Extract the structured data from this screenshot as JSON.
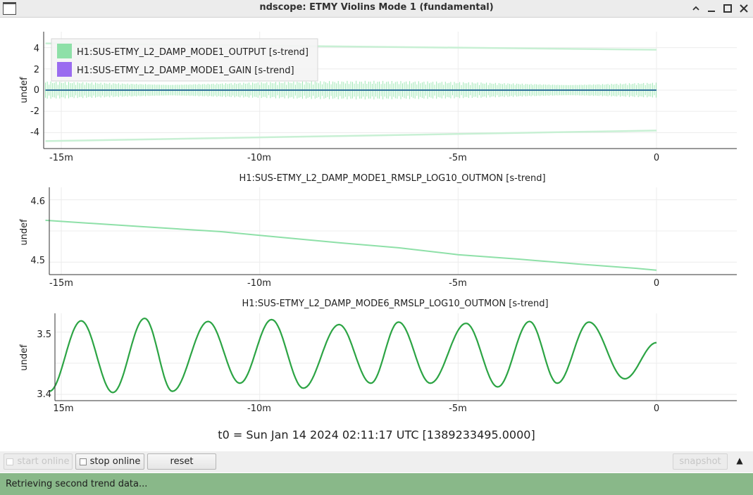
{
  "window": {
    "title": "ndscope: ETMY Violins Mode 1 (fundamental)",
    "controls": {
      "minimize": "–",
      "restore": "^",
      "maximize": "□",
      "close": "✕"
    }
  },
  "plot1": {
    "ylabel": "undef",
    "yticks": [
      "4",
      "2",
      "0",
      "-2",
      "-4"
    ],
    "xticks": [
      "-15m",
      "-10m",
      "-5m",
      "0"
    ],
    "legend": [
      {
        "label": "H1:SUS-ETMY_L2_DAMP_MODE1_OUTPUT [s-trend]",
        "color": "#8ee0a8"
      },
      {
        "label": "H1:SUS-ETMY_L2_DAMP_MODE1_GAIN [s-trend]",
        "color": "#9a6cf0"
      }
    ]
  },
  "plot2": {
    "title": "H1:SUS-ETMY_L2_DAMP_MODE1_RMSLP_LOG10_OUTMON [s-trend]",
    "ylabel": "undef",
    "yticks": [
      "4.6",
      "4.5"
    ],
    "xticks": [
      "-15m",
      "-10m",
      "-5m",
      "0"
    ],
    "color": "#8ee0a8"
  },
  "plot3": {
    "title": "H1:SUS-ETMY_L2_DAMP_MODE6_RMSLP_LOG10_OUTMON [s-trend]",
    "ylabel": "undef",
    "yticks": [
      "3.5",
      "3.4"
    ],
    "xticks": [
      "15m",
      "-10m",
      "-5m",
      "0"
    ],
    "color": "#2ca444"
  },
  "t0_label": "t0 = Sun Jan 14 2024 02:11:17 UTC [1389233495.0000]",
  "toolbar": {
    "start_online": "start online",
    "stop_online": "stop online",
    "reset": "reset",
    "snapshot": "snapshot",
    "collapse_icon": "▲"
  },
  "status": "Retrieving second trend data...",
  "chart_data": [
    {
      "type": "line",
      "title": "",
      "ylabel": "undef",
      "ylim": [
        -5.5,
        5.5
      ],
      "xlim": [
        -15.5,
        2
      ],
      "series": [
        {
          "name": "H1:SUS-ETMY_L2_DAMP_MODE1_OUTPUT [s-trend]",
          "note": "noise band",
          "x": [
            -15.4,
            0
          ],
          "min": [
            -0.9,
            -0.85
          ],
          "max": [
            0.9,
            0.85
          ]
        },
        {
          "name": "H1:SUS-ETMY_L2_DAMP_MODE1_OUTPUT [s-trend]",
          "x": [
            -15.4,
            0
          ],
          "upper": [
            4.4,
            3.8
          ],
          "lower": [
            -4.8,
            -3.8
          ]
        },
        {
          "name": "H1:SUS-ETMY_L2_DAMP_MODE1_GAIN [s-trend]",
          "x": [
            -15.4,
            0
          ],
          "values": [
            0,
            0
          ]
        }
      ]
    },
    {
      "type": "line",
      "title": "H1:SUS-ETMY_L2_DAMP_MODE1_RMSLP_LOG10_OUTMON [s-trend]",
      "ylabel": "undef",
      "ylim": [
        4.48,
        4.62
      ],
      "xlim": [
        -15.5,
        2
      ],
      "series": [
        {
          "name": "H1:SUS-ETMY_L2_DAMP_MODE1_RMSLP_LOG10_OUTMON [s-trend]",
          "x": [
            -15.4,
            -13,
            -11,
            -9.5,
            -8,
            -6.5,
            -5,
            -3.5,
            -2,
            -0.5,
            0
          ],
          "values": [
            4.567,
            4.557,
            4.549,
            4.54,
            4.531,
            4.523,
            4.512,
            4.505,
            4.497,
            4.49,
            4.487
          ]
        }
      ]
    },
    {
      "type": "line",
      "title": "H1:SUS-ETMY_L2_DAMP_MODE6_RMSLP_LOG10_OUTMON [s-trend]",
      "ylabel": "undef",
      "ylim": [
        3.39,
        3.53
      ],
      "xlim": [
        -15.5,
        2
      ],
      "series": [
        {
          "name": "H1:SUS-ETMY_L2_DAMP_MODE6_RMSLP_LOG10_OUTMON [s-trend]",
          "x": [
            -15.3,
            -14.5,
            -13.7,
            -12.9,
            -12.2,
            -11.3,
            -10.5,
            -9.7,
            -8.9,
            -8.0,
            -7.2,
            -6.5,
            -5.7,
            -4.8,
            -4.0,
            -3.2,
            -2.5,
            -1.7,
            -0.8,
            0
          ],
          "values": [
            3.405,
            3.518,
            3.403,
            3.522,
            3.405,
            3.517,
            3.418,
            3.52,
            3.41,
            3.512,
            3.418,
            3.516,
            3.418,
            3.514,
            3.412,
            3.517,
            3.418,
            3.516,
            3.425,
            3.483
          ]
        }
      ]
    }
  ]
}
